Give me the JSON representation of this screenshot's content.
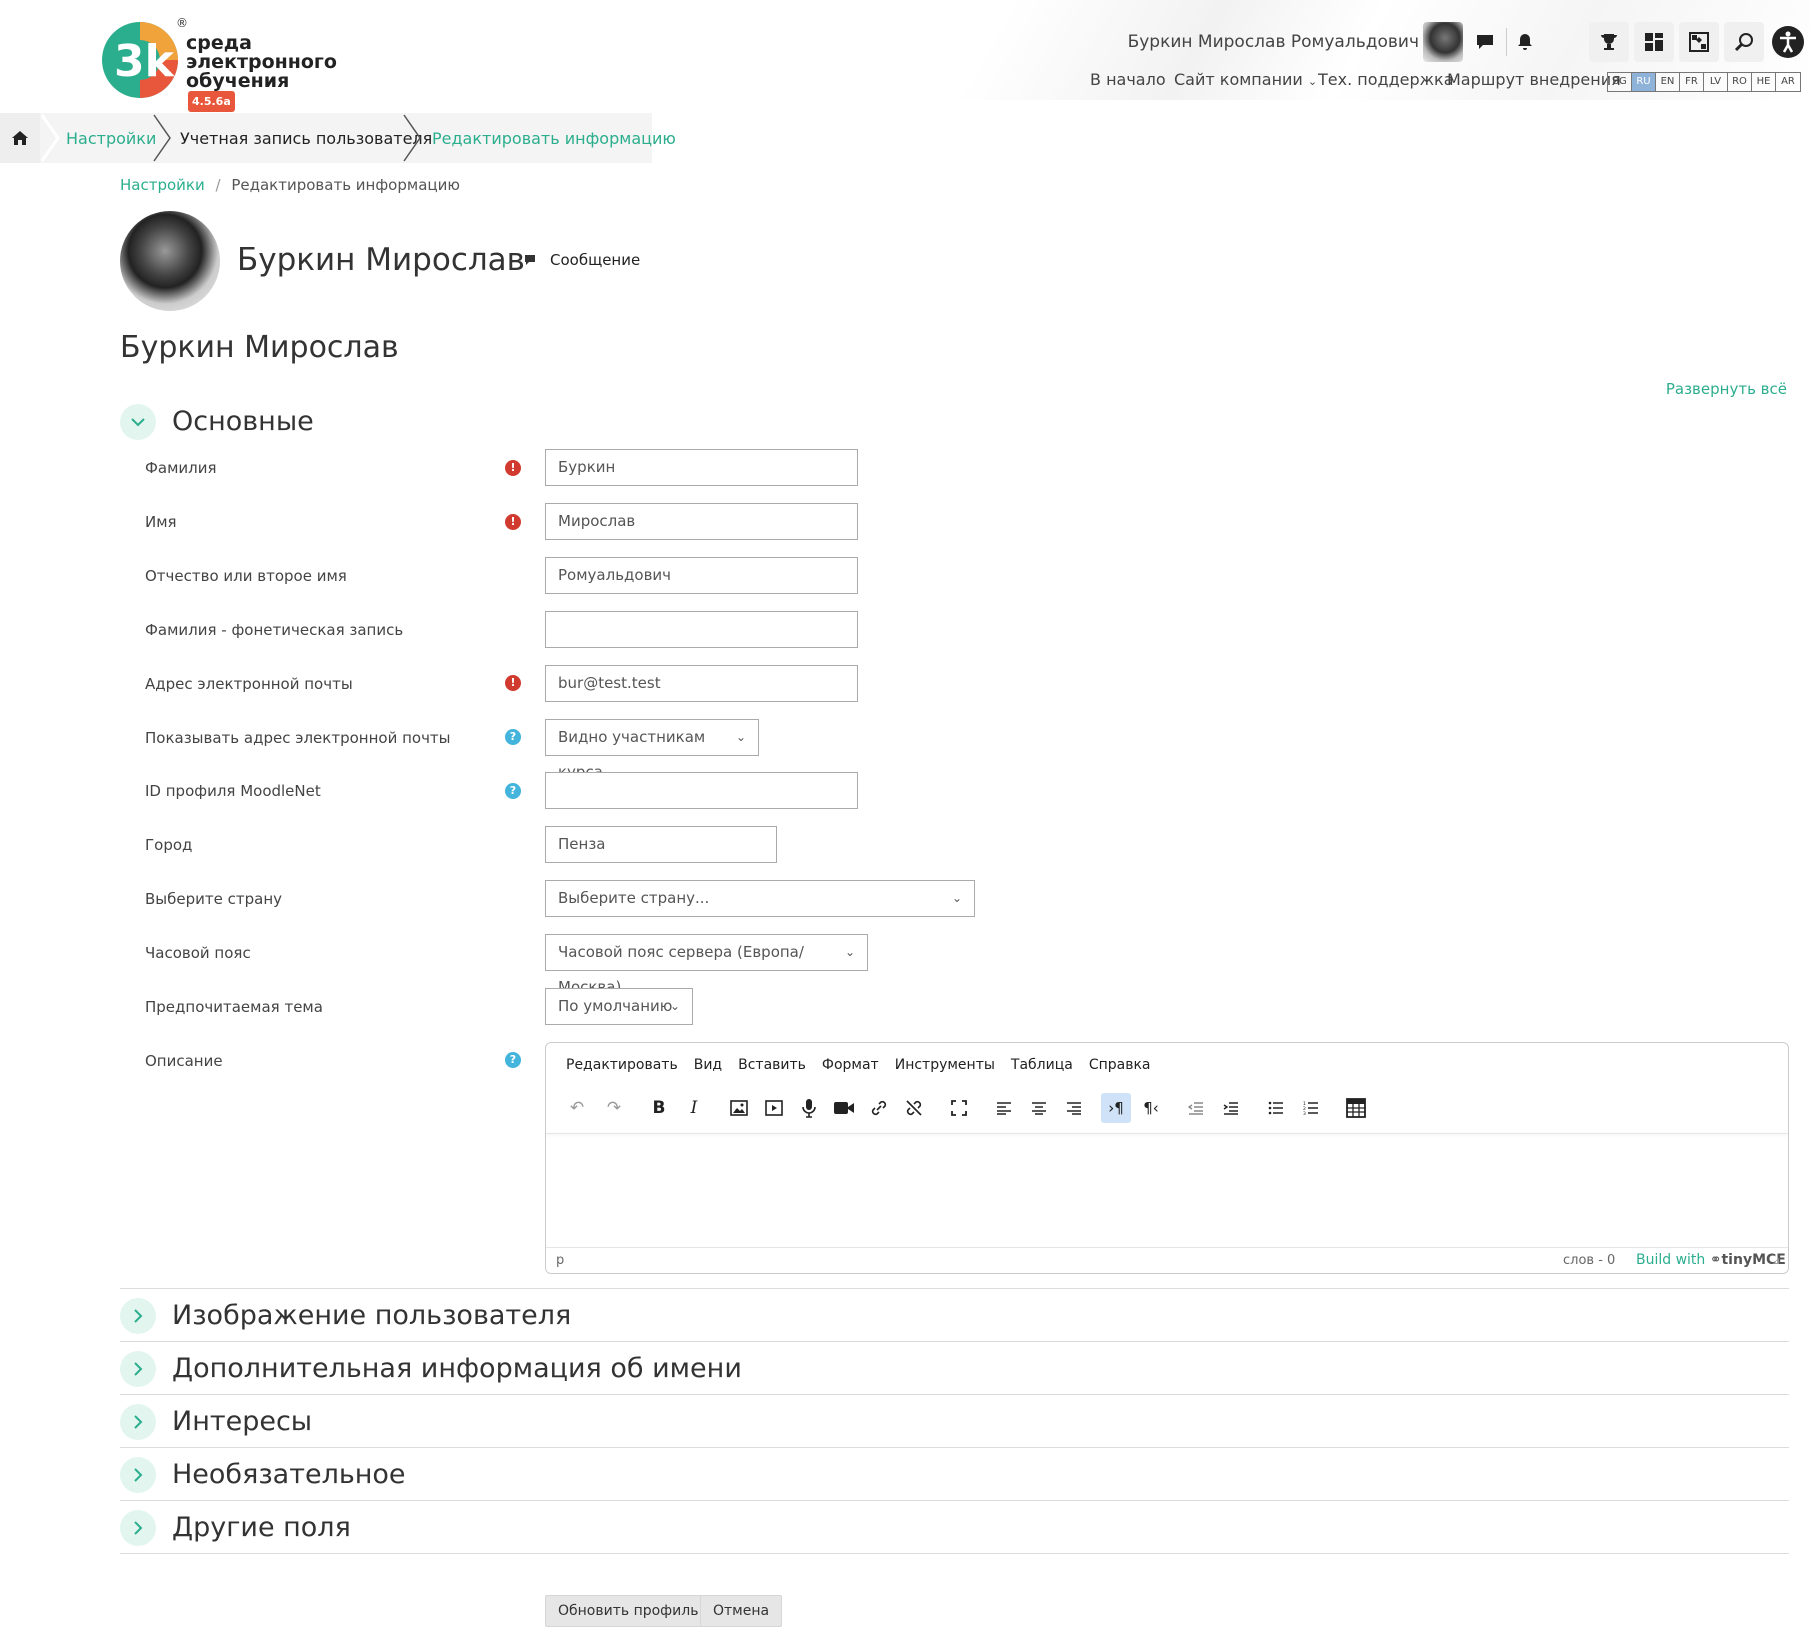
{
  "brand": {
    "line1": "среда",
    "line2": "электронного",
    "line3": "обучения",
    "version": "4.5.6a",
    "registered": "®"
  },
  "header": {
    "user_name": "Буркин Мирослав Ромуальдович",
    "nav": {
      "home": "В начало",
      "company": "Сайт компании",
      "support": "Тех. поддержка",
      "route": "Маршрут внедрения"
    },
    "languages": [
      "BG",
      "RU",
      "EN",
      "FR",
      "LV",
      "RO",
      "HE",
      "AR"
    ],
    "active_language": "RU"
  },
  "crumbs": {
    "items": [
      "Настройки",
      "Учетная запись пользователя",
      "Редактировать информацию"
    ]
  },
  "subcrumb": {
    "first": "Настройки",
    "sep": "/",
    "second": "Редактировать информацию"
  },
  "profile": {
    "name": "Буркин Мирослав",
    "message": "Сообщение"
  },
  "page_title": "Буркин Мирослав",
  "expand_all": "Развернуть всё",
  "sections": {
    "main": "Основные",
    "image": "Изображение пользователя",
    "names": "Дополнительная информация об имени",
    "interests": "Интересы",
    "optional": "Необязательное",
    "other": "Другие поля"
  },
  "form": {
    "lastname": {
      "label": "Фамилия",
      "value": "Буркин"
    },
    "firstname": {
      "label": "Имя",
      "value": "Мирослав"
    },
    "middlename": {
      "label": "Отчество или второе имя",
      "value": "Ромуальдович"
    },
    "phonetic": {
      "label": "Фамилия - фонетическая запись",
      "value": ""
    },
    "email": {
      "label": "Адрес электронной почты",
      "value": "bur@test.test"
    },
    "maildisplay": {
      "label": "Показывать адрес электронной почты",
      "value": "Видно участникам курса"
    },
    "moodlenet": {
      "label": "ID профиля MoodleNet",
      "value": ""
    },
    "city": {
      "label": "Город",
      "value": "Пенза"
    },
    "country": {
      "label": "Выберите страну",
      "value": "Выберите страну..."
    },
    "timezone": {
      "label": "Часовой пояс",
      "value": "Часовой пояс сервера (Европа/Москва)"
    },
    "theme": {
      "label": "Предпочитаемая тема",
      "value": "По умолчанию"
    },
    "description": {
      "label": "Описание"
    }
  },
  "editor": {
    "menu": [
      "Редактировать",
      "Вид",
      "Вставить",
      "Формат",
      "Инструменты",
      "Таблица",
      "Справка"
    ],
    "status_path": "p",
    "word_count": "слов - 0",
    "build_with": "Build with",
    "brand": "tinyMCE"
  },
  "buttons": {
    "submit": "Обновить профиль",
    "cancel": "Отмена"
  },
  "colors": {
    "accent": "#2bae8d",
    "required": "#d13b2f",
    "help": "#43b4dc",
    "active_lang": "#8fb2d9"
  }
}
